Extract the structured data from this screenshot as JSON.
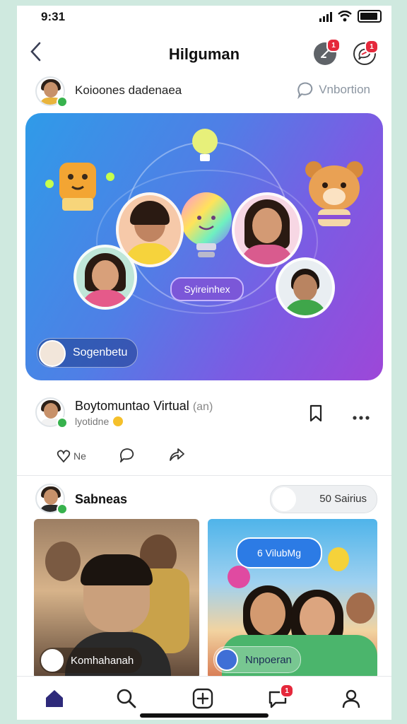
{
  "status_bar": {
    "time": "9:31"
  },
  "header": {
    "title": "Hilguman",
    "notifications_badge": "1",
    "messages_badge": "1"
  },
  "post": {
    "author_name": "Koioones dadenaea",
    "invite_label": "Vnbortion",
    "hero_tag": "Syireinhex",
    "hero_user_label": "Sogenbetu",
    "title": "Boytomuntao",
    "title_suffix": "Virtual",
    "title_extra": "(an)",
    "subtitle": "lyotidne",
    "like_label": "Ne"
  },
  "section": {
    "title": "Sabneas",
    "toggle_label": "50 Sairius"
  },
  "cards": [
    {
      "label": "Komhahanah"
    },
    {
      "label": "Nnpoeran",
      "bubble": "6 VilubMg"
    }
  ],
  "tabs": [
    {
      "name": "home",
      "icon": "home-icon"
    },
    {
      "name": "search",
      "icon": "search-icon"
    },
    {
      "name": "create",
      "icon": "plus-square-icon"
    },
    {
      "name": "messages",
      "icon": "chat-icon",
      "badge": "1"
    },
    {
      "name": "profile",
      "icon": "user-icon"
    }
  ],
  "colors": {
    "accent": "#2e2a7a",
    "badge": "#e5283b",
    "online": "#37b24d"
  }
}
